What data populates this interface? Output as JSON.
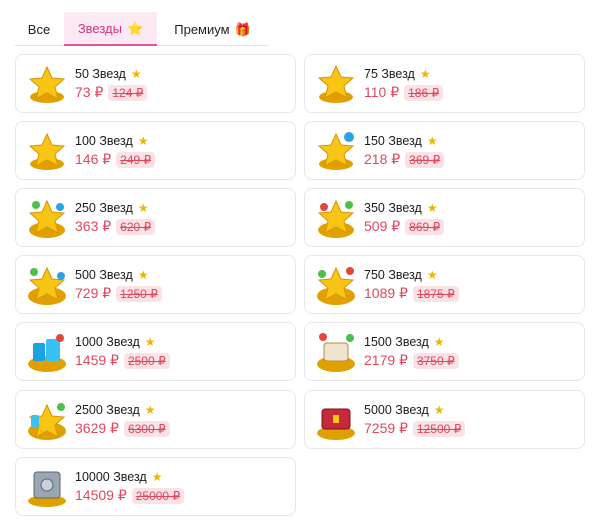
{
  "tabs": [
    {
      "label": "Все",
      "icon": ""
    },
    {
      "label": "Звезды",
      "icon": "⭐"
    },
    {
      "label": "Премиум",
      "icon": "🎁"
    }
  ],
  "products": [
    {
      "title": "50 Звезд",
      "price": "73 ₽",
      "old_price": "124 ₽",
      "icon": "star-pile-icon"
    },
    {
      "title": "75 Звезд",
      "price": "110 ₽",
      "old_price": "186 ₽",
      "icon": "star-pile-icon"
    },
    {
      "title": "100 Звезд",
      "price": "146 ₽",
      "old_price": "249 ₽",
      "icon": "star-pile-icon"
    },
    {
      "title": "150 Звезд",
      "price": "218 ₽",
      "old_price": "369 ₽",
      "icon": "star-pile-icon"
    },
    {
      "title": "250 Звезд",
      "price": "363 ₽",
      "old_price": "620 ₽",
      "icon": "star-pile-icon"
    },
    {
      "title": "350 Звезд",
      "price": "509 ₽",
      "old_price": "869 ₽",
      "icon": "star-pile-icon"
    },
    {
      "title": "500 Звезд",
      "price": "729 ₽",
      "old_price": "1250 ₽",
      "icon": "star-pile-icon"
    },
    {
      "title": "750 Звезд",
      "price": "1089 ₽",
      "old_price": "1875 ₽",
      "icon": "star-pile-icon"
    },
    {
      "title": "1000 Звезд",
      "price": "1459 ₽",
      "old_price": "2500 ₽",
      "icon": "gem-pile-icon"
    },
    {
      "title": "1500 Звезд",
      "price": "2179 ₽",
      "old_price": "3750 ₽",
      "icon": "chest-icon"
    },
    {
      "title": "2500 Звезд",
      "price": "3629 ₽",
      "old_price": "6300 ₽",
      "icon": "treasure-icon"
    },
    {
      "title": "5000 Звезд",
      "price": "7259 ₽",
      "old_price": "12500 ₽",
      "icon": "red-chest-icon"
    },
    {
      "title": "10000 Звезд",
      "price": "14509 ₽",
      "old_price": "25000 ₽",
      "icon": "safe-icon"
    }
  ]
}
